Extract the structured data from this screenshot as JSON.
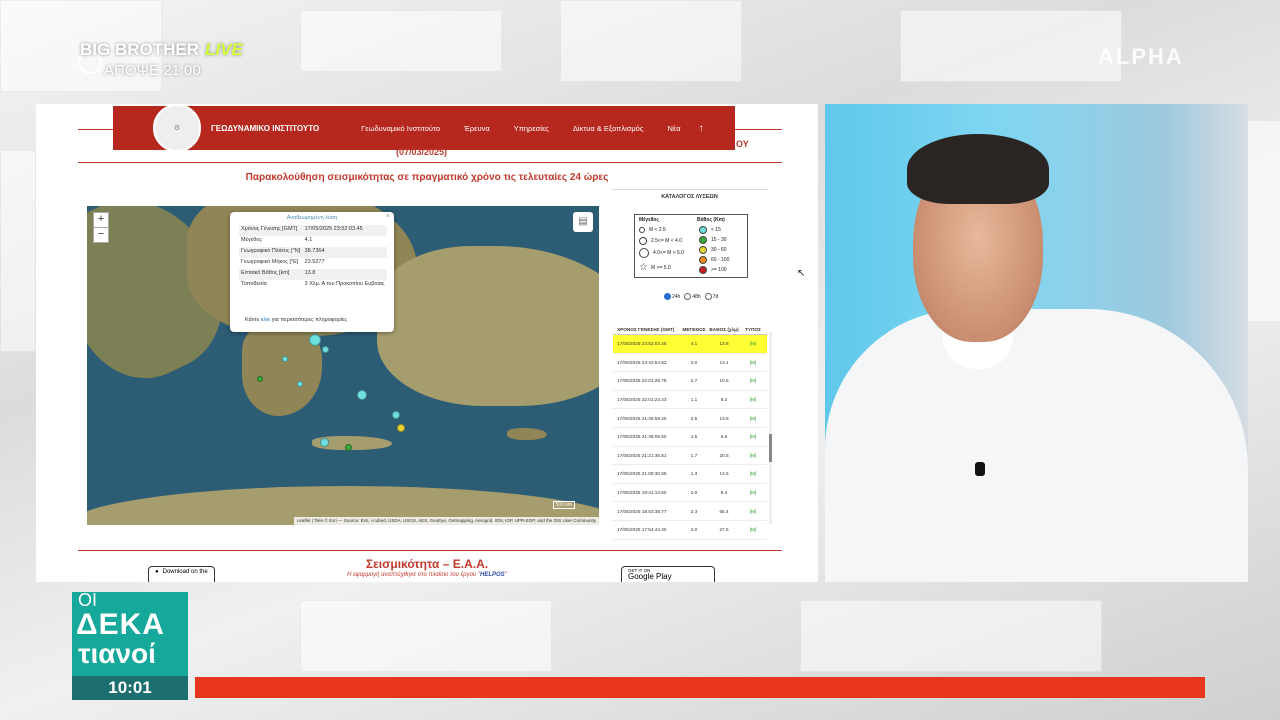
{
  "broadcast": {
    "show_top": "BIG BROTHER",
    "live_label": "LIVE",
    "show_time": "ΑΠΟΨΕ 21:00",
    "program_logo": {
      "oi": "ΟΙ",
      "line1": "ΔΕΚΑ",
      "line2": "τιανοί"
    },
    "clock": "10:01",
    "accent_colors": {
      "teal": "#16a89a",
      "red": "#e8351e"
    }
  },
  "site": {
    "brand": "ΓΕΩΔΥΝΑΜΙΚΟ ΙΝΣΤΙΤΟΥΤΟ",
    "nav": [
      "Γεωδυναμικό Ινστιτούτο",
      "Έρευνα",
      "Υπηρεσίες",
      "Δίκτυα & Εξοπλισμός",
      "Νέα"
    ],
    "date_text": "(07/03/2025)",
    "trunc_text": "ΟΥ",
    "heading": "Παρακολούθηση σεισμικότητας σε πραγματικό χρόνο τις τελευταίες 24 ώρες",
    "popup": {
      "title": "Αναθεωρημένη λύση",
      "rows": [
        {
          "k": "Χρόνος Γένεσης [GMT]",
          "v": "17/05/2025 23:52:03.45"
        },
        {
          "k": "Μέγεθος",
          "v": "4.1"
        },
        {
          "k": "Γεωγραφικό Πλάτος [°N]",
          "v": "38.7364"
        },
        {
          "k": "Γεωγραφικό Μήκος [°E]",
          "v": "23.5277"
        },
        {
          "k": "Εστιακό Βάθος [km]",
          "v": "13.8"
        },
        {
          "k": "Τοποθεσία",
          "v": "3 Χλμ. Α του Προκοπίου Ευβοίας"
        }
      ],
      "more_prefix": "Κάντε",
      "more_link": "κλικ",
      "more_suffix": "για περισσότερες πληροφορίες"
    },
    "map_attrib": "Leaflet | Tiles © Esri — Source: Esri, i-cubed, USDA, USGS, AEX, GeoEye, Getmapping, Aerogrid, IGN, IGP, UPR-EGP, and the GIS User Community",
    "scale": "500 km",
    "catalog_title": "ΚΑΤΑΛΟΓΟΣ ΛΥΣΕΩΝ",
    "legend": {
      "mag_header": "Μέγεθος",
      "depth_header": "Βάθος (Km)",
      "mags": [
        "M < 2.5",
        "2.5<= M < 4.0",
        "4.0<= M < 5.0",
        "M >= 5.0"
      ],
      "depths": [
        {
          "label": "< 15",
          "color": "#6fe0e0"
        },
        {
          "label": "15 - 30",
          "color": "#3aa83a"
        },
        {
          "label": "30 - 60",
          "color": "#e8d630"
        },
        {
          "label": "60 - 100",
          "color": "#e88a1c"
        },
        {
          "label": ">= 100",
          "color": "#c81e1e"
        }
      ]
    },
    "radios": [
      "24h",
      "48h",
      "7d"
    ],
    "table_head": [
      "ΧΡΟΝΟΣ ΓΕΝΕΣΗΣ (GMT)",
      "ΜΕΓΕΘΟΣ",
      "ΒΑΘΟΣ (χλμ)",
      "ΤΥΠΟΣ"
    ],
    "quakes": [
      {
        "t": "17/05/2025 23:52:03.45",
        "m": "4.1",
        "d": "13.8",
        "ty": "[M]"
      },
      {
        "t": "17/05/2025 23:33:54.82",
        "m": "2.0",
        "d": "13.1",
        "ty": "[M]"
      },
      {
        "t": "17/05/2025 22:01:28.78",
        "m": "2.7",
        "d": "10.5",
        "ty": "[M]"
      },
      {
        "t": "17/05/2025 22:01:23.43",
        "m": "1.1",
        "d": "8.2",
        "ty": "[M]"
      },
      {
        "t": "17/05/2025 21:45:59.20",
        "m": "2.5",
        "d": "13.8",
        "ty": "[M]"
      },
      {
        "t": "17/05/2025 21:36:05.50",
        "m": "1.5",
        "d": "6.6",
        "ty": "[M]"
      },
      {
        "t": "17/05/2025 21:21:35.51",
        "m": "1.7",
        "d": "20.8",
        "ty": "[M]"
      },
      {
        "t": "17/05/2025 21:09:30.56",
        "m": "1.3",
        "d": "13.5",
        "ty": "[M]"
      },
      {
        "t": "17/05/2025 19:41:13.60",
        "m": "2.0",
        "d": "9.4",
        "ty": "[M]"
      },
      {
        "t": "17/05/2025 18:53:38.77",
        "m": "2.3",
        "d": "65.4",
        "ty": "[M]"
      },
      {
        "t": "17/05/2025 17:54:44.30",
        "m": "2.0",
        "d": "27.5",
        "ty": "[M]"
      }
    ],
    "app_title": "Σεισμικότητα – Ε.Α.Α.",
    "app_sub_prefix": "Η εφαρμογή αναπτύχθηκε στο πλαίσιο του έργου \"",
    "app_sub_project": "HELPOS",
    "app_sub_suffix": "\"",
    "app_store": "Download on the",
    "google_play_top": "GET IT ON",
    "google_play": "Google Play"
  }
}
